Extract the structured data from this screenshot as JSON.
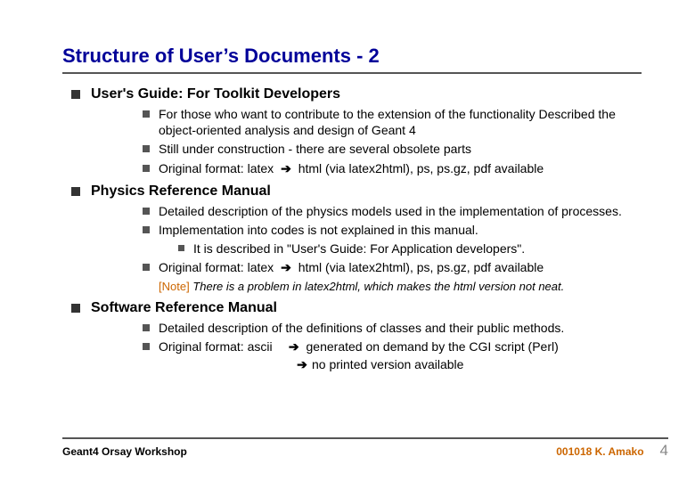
{
  "title": "Structure of User’s Documents - 2",
  "sections": [
    {
      "heading": "User's Guide: For Toolkit Developers",
      "items": [
        {
          "text": "For those who want to contribute to the extension of the functionality Described the object-oriented analysis and design of Geant 4"
        },
        {
          "text": "Still under construction - there are several obsolete parts"
        },
        {
          "lead": "Original format: latex",
          "tail": "html (via latex2html), ps, ps.gz, pdf available"
        }
      ]
    },
    {
      "heading": "Physics Reference Manual",
      "items": [
        {
          "text": "Detailed description of the physics models used in the implementation of processes."
        },
        {
          "text": "Implementation into codes is not explained in this manual.",
          "sub": [
            {
              "text": "It is described in \"User's Guide: For Application developers\"."
            }
          ]
        },
        {
          "lead": "Original format: latex",
          "tail": "html (via latex2html), ps, ps.gz, pdf available"
        }
      ],
      "note": {
        "label": "[Note]",
        "text": "There is a problem in latex2html, which makes the html version not neat."
      }
    },
    {
      "heading": "Software Reference Manual",
      "items": [
        {
          "text": "Detailed description of the definitions of classes and their public methods."
        },
        {
          "lead": "Original format: ascii",
          "tails": [
            "generated on demand by the CGI script (Perl)",
            "no printed version available"
          ]
        }
      ]
    }
  ],
  "footer": {
    "left": "Geant4 Orsay Workshop",
    "date_author": "001018  K. Amako",
    "page": "4"
  },
  "arrow_glyph": "➔"
}
